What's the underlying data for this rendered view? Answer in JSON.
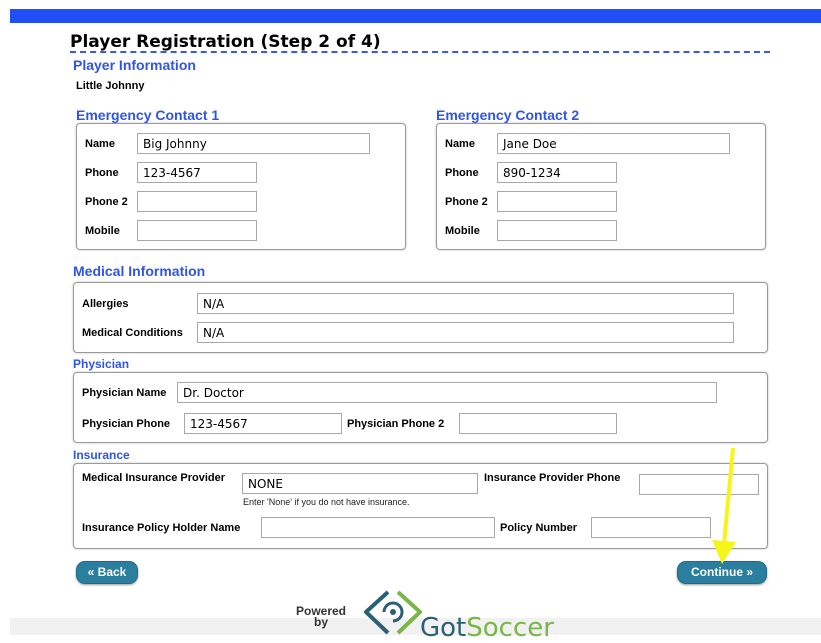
{
  "page": {
    "title": "Player Registration (Step 2 of 4)"
  },
  "player": {
    "heading": "Player Information",
    "name": "Little  Johnny"
  },
  "contact1": {
    "heading": "Emergency Contact 1",
    "name_label": "Name",
    "name": "Big Johnny",
    "phone_label": "Phone",
    "phone": "123-4567",
    "phone2_label": "Phone 2",
    "phone2": "",
    "mobile_label": "Mobile",
    "mobile": ""
  },
  "contact2": {
    "heading": "Emergency Contact 2",
    "name_label": "Name",
    "name": "Jane Doe",
    "phone_label": "Phone",
    "phone": "890-1234",
    "phone2_label": "Phone 2",
    "phone2": "",
    "mobile_label": "Mobile",
    "mobile": ""
  },
  "medical": {
    "heading": "Medical Information",
    "allergies_label": "Allergies",
    "allergies": "N/A",
    "conditions_label": "Medical Conditions",
    "conditions": "N/A"
  },
  "physician": {
    "heading": "Physician",
    "name_label": "Physician Name",
    "name": "Dr. Doctor",
    "phone_label": "Physician Phone",
    "phone": "123-4567",
    "phone2_label": "Physician Phone 2",
    "phone2": ""
  },
  "insurance": {
    "heading": "Insurance",
    "provider_label": "Medical Insurance Provider",
    "provider": "NONE",
    "provider_hint": "Enter 'None' if you do not have insurance.",
    "provider_phone_label": "Insurance Provider Phone",
    "provider_phone": "",
    "holder_label": "Insurance Policy Holder Name",
    "holder": "",
    "policy_label": "Policy Number",
    "policy": ""
  },
  "buttons": {
    "back": "« Back",
    "continue": "Continue »"
  },
  "footer": {
    "powered_by": "Powered\nby",
    "logo_part1": "Got",
    "logo_part2": "Soccer"
  },
  "annotation": {
    "arrow_color": "#f5f51a"
  }
}
